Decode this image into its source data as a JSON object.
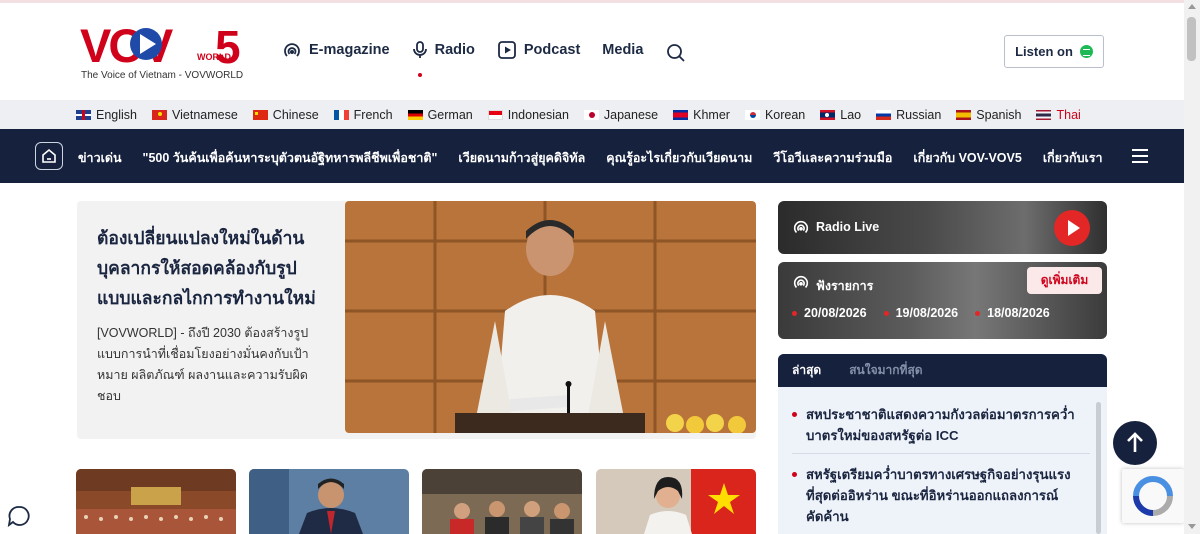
{
  "header": {
    "logo_text": "VOV",
    "logo_world": "WORLD",
    "logo_num": "5",
    "tagline": "The Voice of Vietnam - VOVWORLD",
    "nav": [
      {
        "label": "E-magazine",
        "icon": "broadcast-icon"
      },
      {
        "label": "Radio",
        "icon": "microphone-icon"
      },
      {
        "label": "Podcast",
        "icon": "play-square-icon"
      },
      {
        "label": "Media",
        "icon": ""
      }
    ],
    "listen_label": "Listen on",
    "colors": {
      "brand_red": "#d0021b",
      "navy": "#16213e",
      "spotify": "#1db954"
    }
  },
  "languages": [
    {
      "label": "English",
      "flag": "uk"
    },
    {
      "label": "Vietnamese",
      "flag": "vn"
    },
    {
      "label": "Chinese",
      "flag": "cn"
    },
    {
      "label": "French",
      "flag": "fr"
    },
    {
      "label": "German",
      "flag": "de"
    },
    {
      "label": "Indonesian",
      "flag": "id"
    },
    {
      "label": "Japanese",
      "flag": "jp"
    },
    {
      "label": "Khmer",
      "flag": "kh"
    },
    {
      "label": "Korean",
      "flag": "kr"
    },
    {
      "label": "Lao",
      "flag": "la"
    },
    {
      "label": "Russian",
      "flag": "ru"
    },
    {
      "label": "Spanish",
      "flag": "es"
    },
    {
      "label": "Thai",
      "flag": "th",
      "active": true
    }
  ],
  "mainnav": {
    "links": [
      "ข่าวเด่น",
      "\"500 วันค้นเพื่อค้นหาระบุตัวตนอัฐิทหารพลีชีพเพื่อชาติ\"",
      "เวียดนามก้าวสู่ยุคดิจิทัล",
      "คุณรู้อะไรเกี่ยวกับเวียดนาม",
      "วีโอวีและความร่วมมือ",
      "เกี่ยวกับ VOV-VOV5",
      "เกี่ยวกับเรา"
    ]
  },
  "feature": {
    "title": "ต้องเปลี่ยนแปลงใหม่ในด้านบุคลากรให้สอดคล้องกับรูปแบบและกลไกการทำงานใหม่",
    "summary": "[VOVWORLD] - ถึงปี 2030 ต้องสร้างรูปแบบการนำที่เชื่อมโยงอย่างมั่นคงกับเป้าหมาย ผลิตภัณฑ์ ผลงานและความรับผิดชอบ"
  },
  "radio_live": {
    "label": "Radio Live"
  },
  "podcast_box": {
    "label": "ฟังรายการ",
    "more": "ดูเพิ่มเติม",
    "dates": [
      "20/08/2026",
      "19/08/2026",
      "18/08/2026"
    ]
  },
  "news": {
    "tabs": [
      "ล่าสุด",
      "สนใจมากที่สุด"
    ],
    "items": [
      "สหประชาชาติแสดงความกังวลต่อมาตรการคว่ำบาตรใหม่ของสหรัฐต่อ ICC",
      "สหรัฐเตรียมคว่ำบาตรทางเศรษฐกิจอย่างรุนแรงที่สุดต่ออิหร่าน ขณะที่อิหร่านออกแถลงการณ์คัดค้าน"
    ]
  }
}
